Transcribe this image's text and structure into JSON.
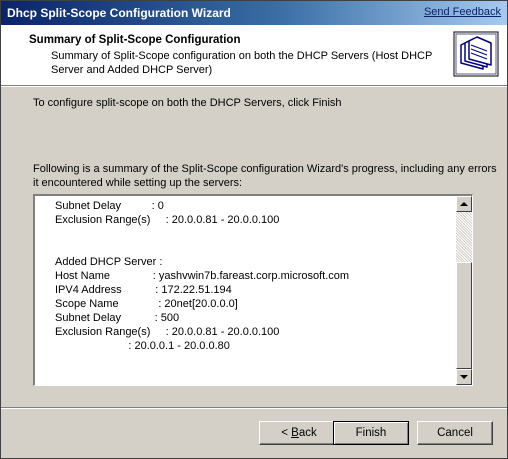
{
  "window": {
    "title": "Dhcp Split-Scope Configuration Wizard",
    "feedback_link": "Send Feedback"
  },
  "header": {
    "heading": "Summary of Split-Scope Configuration",
    "description": "Summary of Split-Scope configuration on both the DHCP Servers (Host DHCP Server and Added DHCP Server)",
    "icon": "folders-icon"
  },
  "instruction": "To configure split-scope on both the DHCP Servers, click Finish",
  "summary_intro": "Following is a summary of the Split-Scope configuration Wizard's progress, including any errors it encountered while setting up the servers:",
  "summary_lines": [
    "Subnet Delay          : 0",
    "Exclusion Range(s)     : 20.0.0.81 - 20.0.0.100",
    "",
    "",
    "Added DHCP Server :",
    "Host Name              : yashvwin7b.fareast.corp.microsoft.com",
    "IPV4 Address           : 172.22.51.194",
    "Scope Name             : 20net[20.0.0.0]",
    "Subnet Delay           : 500",
    "Exclusion Range(s)     : 20.0.0.81 - 20.0.0.100",
    "                        : 20.0.0.1 - 20.0.0.80"
  ],
  "buttons": {
    "back_prefix": "< ",
    "back_accel": "B",
    "back_rest": "ack",
    "finish": "Finish",
    "cancel": "Cancel"
  }
}
